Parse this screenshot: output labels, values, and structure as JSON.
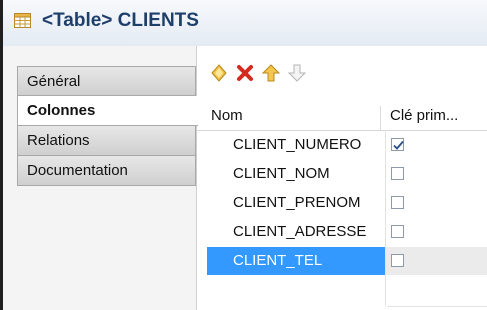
{
  "header": {
    "title": "<Table> CLIENTS",
    "icon": "table-icon"
  },
  "sidebar": {
    "tabs": [
      {
        "label": "Général"
      },
      {
        "label": "Colonnes",
        "active": true
      },
      {
        "label": "Relations"
      },
      {
        "label": "Documentation"
      }
    ]
  },
  "toolbar": {
    "buttons": [
      {
        "icon": "add-diamond-icon",
        "color": "#e8b83a"
      },
      {
        "icon": "delete-x-icon",
        "color": "#d42b1e"
      },
      {
        "icon": "arrow-up-icon",
        "color": "#e8b83a"
      },
      {
        "icon": "arrow-down-icon",
        "color": "#b5b5b5"
      }
    ]
  },
  "table": {
    "columns": [
      "Nom",
      "Clé prim..."
    ],
    "rows": [
      {
        "name": "CLIENT_NUMERO",
        "primary_key": true
      },
      {
        "name": "CLIENT_NOM",
        "primary_key": false
      },
      {
        "name": "CLIENT_PRENOM",
        "primary_key": false
      },
      {
        "name": "CLIENT_ADRESSE",
        "primary_key": false
      },
      {
        "name": "CLIENT_TEL",
        "primary_key": false,
        "selected": true
      }
    ]
  },
  "colors": {
    "selection": "#3399ff",
    "title": "#1f3f6b",
    "check": "#2a4f8a"
  }
}
